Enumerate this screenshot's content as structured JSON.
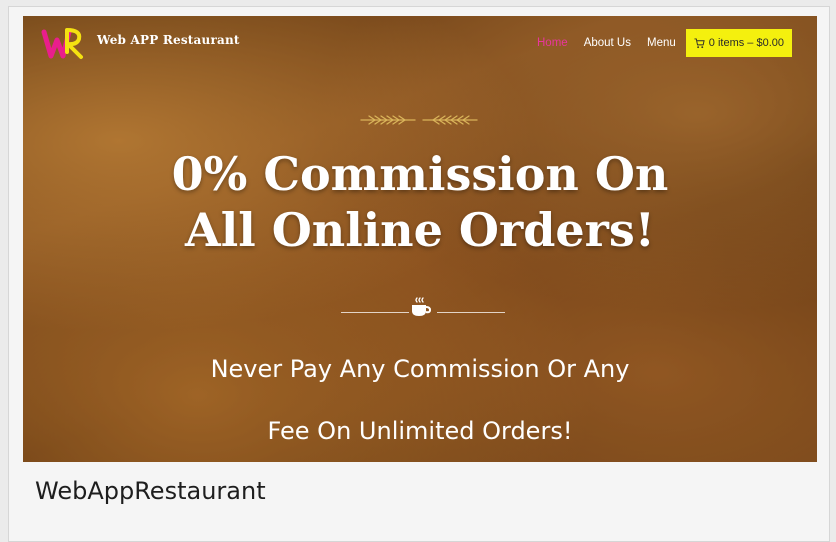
{
  "header": {
    "brand": "Web APP Restaurant",
    "nav": [
      {
        "label": "Home",
        "active": true
      },
      {
        "label": "About Us",
        "active": false
      },
      {
        "label": "Menu",
        "active": false
      }
    ],
    "cart_label": "0 items – $0.00"
  },
  "hero": {
    "headline_line1": "0% Commission On",
    "headline_line2": "All Online Orders!",
    "subtitle_line1": "Never Pay Any Commission Or Any",
    "subtitle_line2": "Fee On Unlimited Orders!"
  },
  "caption": "WebAppRestaurant",
  "colors": {
    "nav_active": "#e8369c",
    "cart_bg": "#f4f00e",
    "logo_magenta": "#e91e8c",
    "logo_yellow": "#f4e211",
    "wheat_gold": "#d9b45a"
  },
  "icons": [
    "logo-icon",
    "cart-icon",
    "wheat-icon",
    "coffee-icon"
  ]
}
